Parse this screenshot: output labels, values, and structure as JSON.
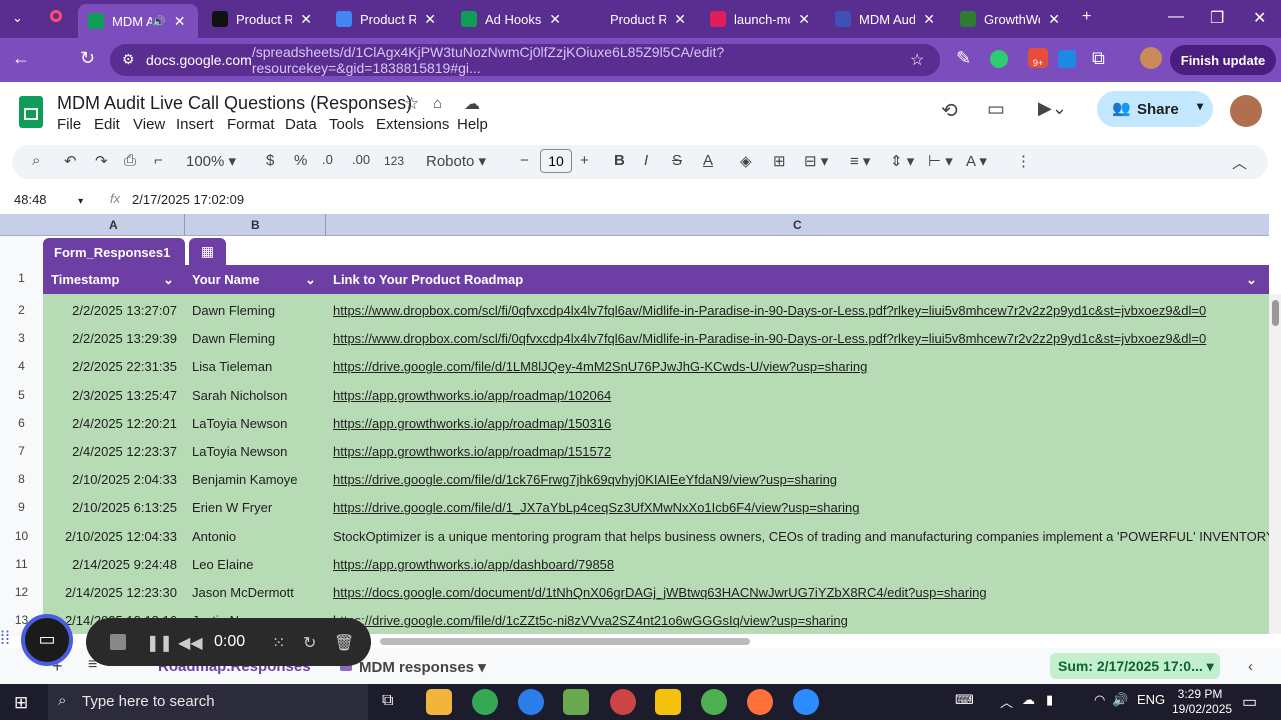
{
  "browser": {
    "tabs": [
      {
        "title": "MDM A",
        "active": true,
        "icon_color": "#0f9d58",
        "has_audio": true
      },
      {
        "title": "Product Ro",
        "icon_color": "#111111"
      },
      {
        "title": "Product Ro",
        "icon_color": "#4285f4"
      },
      {
        "title": "Ad Hooks a",
        "icon_color": "#0f9d58"
      },
      {
        "title": "Product Ro",
        "icon_color": "#5a2d91"
      },
      {
        "title": "launch-mo",
        "icon_color": "#e01e5a"
      },
      {
        "title": "MDM Audi",
        "icon_color": "#3f51b5"
      },
      {
        "title": "GrowthWo",
        "icon_color": "#2e7d32"
      }
    ],
    "url_host": "docs.google.com",
    "url_path": "/spreadsheets/d/1ClAgx4KjPW3tuNozNwmCj0lfZzjKOiuxe6L85Z9l5CA/edit?resourcekey=&gid=1838815819#gi...",
    "finish_update_label": "Finish update",
    "ext_badge": "9+"
  },
  "sheets": {
    "title": "MDM Audit Live Call Questions (Responses)",
    "menu": [
      "File",
      "Edit",
      "View",
      "Insert",
      "Format",
      "Data",
      "Tools",
      "Extensions",
      "Help"
    ],
    "share_label": "Share",
    "toolbar": {
      "zoom": "100%",
      "currency": "$",
      "percent": "%",
      "dec_decrease": ".0",
      "dec_increase": ".00",
      "number_format": "123",
      "font": "Roboto",
      "font_size": "10"
    },
    "name_box": "48:48",
    "formula_value": "2/17/2025 17:02:09",
    "columns": [
      "A",
      "B",
      "C"
    ],
    "table_name": "Form_Responses1",
    "headers": [
      "Timestamp",
      "Your Name",
      "Link to Your Product Roadmap"
    ],
    "row_numbers": [
      "1",
      "2",
      "3",
      "4",
      "5",
      "6",
      "7",
      "8",
      "9",
      "10",
      "11",
      "12",
      "13"
    ],
    "rows": [
      {
        "ts": "2/2/2025 13:27:07",
        "name": "Dawn Fleming",
        "link": "https://www.dropbox.com/scl/fi/0qfvxcdp4lx4lv7fql6av/Midlife-in-Paradise-in-90-Days-or-Less.pdf?rlkey=liui5v8mhcew7r2v2z2p9yd1c&st=jvbxoez9&dl=0"
      },
      {
        "ts": "2/2/2025 13:29:39",
        "name": "Dawn Fleming",
        "link": "https://www.dropbox.com/scl/fi/0qfvxcdp4lx4lv7fql6av/Midlife-in-Paradise-in-90-Days-or-Less.pdf?rlkey=liui5v8mhcew7r2v2z2p9yd1c&st=jvbxoez9&dl=0"
      },
      {
        "ts": "2/2/2025 22:31:35",
        "name": "Lisa Tieleman",
        "link": "https://drive.google.com/file/d/1LM8lJQey-4mM2SnU76PJwJhG-KCwds-U/view?usp=sharing"
      },
      {
        "ts": "2/3/2025 13:25:47",
        "name": "Sarah Nicholson",
        "link": "https://app.growthworks.io/app/roadmap/102064"
      },
      {
        "ts": "2/4/2025 12:20:21",
        "name": "LaToyia Newson",
        "link": "https://app.growthworks.io/app/roadmap/150316"
      },
      {
        "ts": "2/4/2025 12:23:37",
        "name": "LaToyia Newson",
        "link": "https://app.growthworks.io/app/roadmap/151572"
      },
      {
        "ts": "2/10/2025 2:04:33",
        "name": "Benjamin Kamoye",
        "link": "https://drive.google.com/file/d/1ck76Frwg7jhk69qvhyj0KIAIEeYfdaN9/view?usp=sharing"
      },
      {
        "ts": "2/10/2025 6:13:25",
        "name": "Erien W Fryer",
        "link": "https://drive.google.com/file/d/1_JX7aYbLp4ceqSz3UfXMwNxXo1Icb6F4/view?usp=sharing"
      },
      {
        "ts": "2/10/2025 12:04:33",
        "name": "Antonio",
        "link": "StockOptimizer is a unique mentoring program that helps business owners, CEOs of trading and manufacturing companies implement a 'POWERFUL' INVENTORY CONTR",
        "plain": true
      },
      {
        "ts": "2/14/2025 9:24:48",
        "name": "Leo Elaine",
        "link": "https://app.growthworks.io/app/dashboard/79858"
      },
      {
        "ts": "2/14/2025 12:23:30",
        "name": "Jason McDermott",
        "link": "https://docs.google.com/document/d/1tNhQnX06grDAGj_jWBtwq63HACNwJwrUG7iYZbX8RC4/edit?usp=sharing"
      },
      {
        "ts": "2/14/2025 18:18:16",
        "name": "Justin Naus",
        "link": "https://drive.google.com/file/d/1cZZt5c-ni8zVVva2SZ4nt21o6wGGGsIq/view?usp=sharing"
      }
    ],
    "sheet_tabs": [
      "Roadmap.Responses",
      "MDM responses"
    ],
    "sum_label": "Sum: 2/17/2025 17:0..."
  },
  "recorder": {
    "time": "0:00"
  },
  "taskbar": {
    "search_placeholder": "Type here to search",
    "lang": "ENG",
    "time": "3:29 PM",
    "date": "19/02/2025"
  }
}
